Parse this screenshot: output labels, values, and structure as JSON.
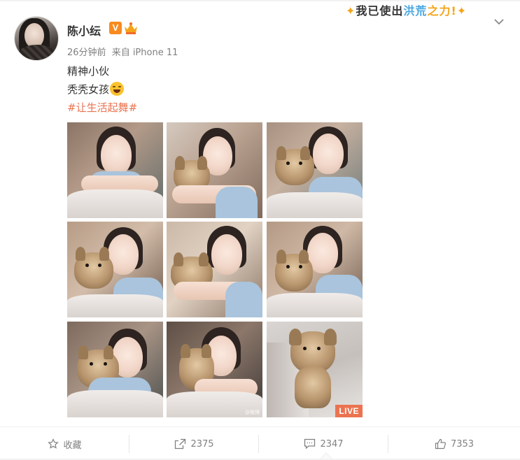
{
  "post": {
    "username": "陈小纭",
    "verified_mark": "V",
    "time": "26分钟前",
    "source": "来自 iPhone 11",
    "text_line1": "精神小伙",
    "text_line2": "秃秃女孩",
    "hashtag": "#让生活起舞#"
  },
  "promo_banner": {
    "part1": "我已使出",
    "part2": "洪荒",
    "part3": "之力",
    "spark": "!"
  },
  "media": {
    "live_label": "LIVE",
    "watermark": "@微博"
  },
  "actions": {
    "favorite_label": "收藏",
    "repost_count": "2375",
    "comment_count": "2347",
    "like_count": "7353"
  },
  "colors": {
    "accent": "#eb7350",
    "verified": "#f78b1f",
    "text": "#333333",
    "muted": "#808080"
  }
}
